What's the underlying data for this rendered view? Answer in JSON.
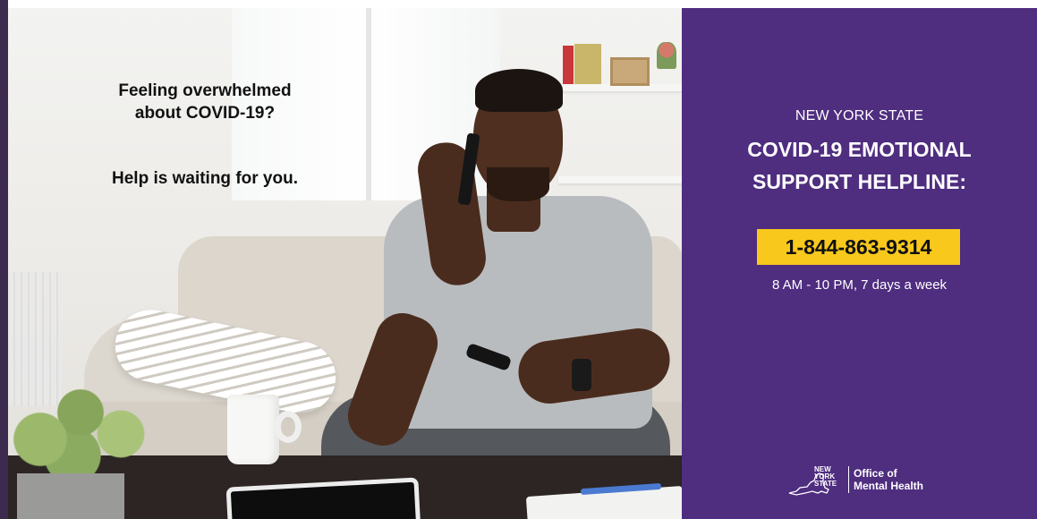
{
  "ad": {
    "headline_line1": "Feeling overwhelmed",
    "headline_line2": "about COVID-19?",
    "subhead": "Help is waiting for you."
  },
  "panel": {
    "state_label": "NEW YORK STATE",
    "title_line1": "COVID-19 EMOTIONAL",
    "title_line2": "SUPPORT HELPLINE:",
    "phone_number": "1-844-863-9314",
    "hours": "8 AM - 10 PM, 7 days a week",
    "logo": {
      "nys_line1": "NEW",
      "nys_line2": "YORK",
      "nys_line3": "STATE",
      "office_line1": "Office of",
      "office_line2": "Mental Health"
    },
    "colors": {
      "background": "#4f2d7f",
      "phone_badge": "#f8c81c",
      "text": "#ffffff"
    }
  },
  "photo": {
    "icon": "man-on-phone-photo"
  }
}
